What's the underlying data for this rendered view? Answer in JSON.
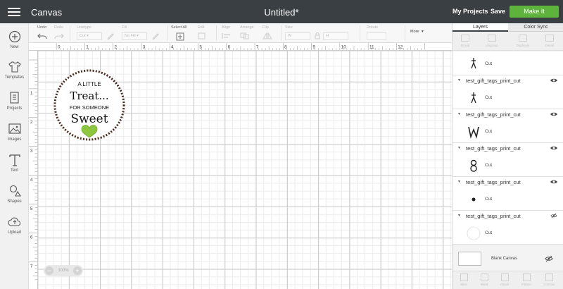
{
  "header": {
    "app_title": "Canvas",
    "doc_title": "Untitled*",
    "my_projects": "My Projects",
    "save": "Save",
    "make_it": "Make It",
    "make_it_color": "#5db33c"
  },
  "sidebar": {
    "items": [
      {
        "label": "New",
        "icon": "plus-circle-icon"
      },
      {
        "label": "Templates",
        "icon": "tshirt-icon"
      },
      {
        "label": "Projects",
        "icon": "projects-icon"
      },
      {
        "label": "Images",
        "icon": "image-icon"
      },
      {
        "label": "Text",
        "icon": "text-icon"
      },
      {
        "label": "Shapes",
        "icon": "shapes-icon"
      },
      {
        "label": "Upload",
        "icon": "upload-cloud-icon"
      }
    ]
  },
  "toolbar": {
    "undo": "Undo",
    "redo": "Redo",
    "linetype_label": "Linetype",
    "linetype_value": "Cut",
    "fill_label": "Fill",
    "fill_value": "No Fill",
    "select_all": "Select All",
    "edit": "Edit",
    "align": "Align",
    "arrange": "Arrange",
    "flip": "Flip",
    "size": "Size",
    "size_w": "W",
    "size_h": "H",
    "rotate": "Rotate",
    "more": "More"
  },
  "rulers": {
    "x": [
      "0",
      "1",
      "2",
      "3",
      "4",
      "5",
      "6",
      "7",
      "8",
      "9",
      "10",
      "11",
      "12"
    ],
    "y": [
      "1",
      "2",
      "3",
      "4",
      "5",
      "6",
      "7"
    ]
  },
  "design": {
    "line1": "A LITTLE",
    "line2": "Treat...",
    "line3": "FOR SOMEONE",
    "line4": "Sweet",
    "heart_color": "#8dc63f"
  },
  "zoom": {
    "value": "100%"
  },
  "panel": {
    "tab_layers": "Layers",
    "tab_color_sync": "Color Sync",
    "tools": [
      "Group",
      "Ungroup",
      "Duplicate",
      "Delete"
    ],
    "first_cut": "Cut",
    "layers": [
      {
        "name": "test_gift_tags_print_cut",
        "op": "Cut",
        "thumb": "figure"
      },
      {
        "name": "test_gift_tags_print_cut",
        "op": "Cut",
        "thumb": "W"
      },
      {
        "name": "test_gift_tags_print_cut",
        "op": "Cut",
        "thumb": "8"
      },
      {
        "name": "test_gift_tags_print_cut",
        "op": "Cut",
        "thumb": "dot"
      },
      {
        "name": "test_gift_tags_print_cut",
        "op": "Cut",
        "thumb": "circle"
      }
    ],
    "blank_canvas": "Blank Canvas",
    "footer": [
      "Slice",
      "Weld",
      "Attach",
      "Flatten",
      "Contour"
    ]
  }
}
